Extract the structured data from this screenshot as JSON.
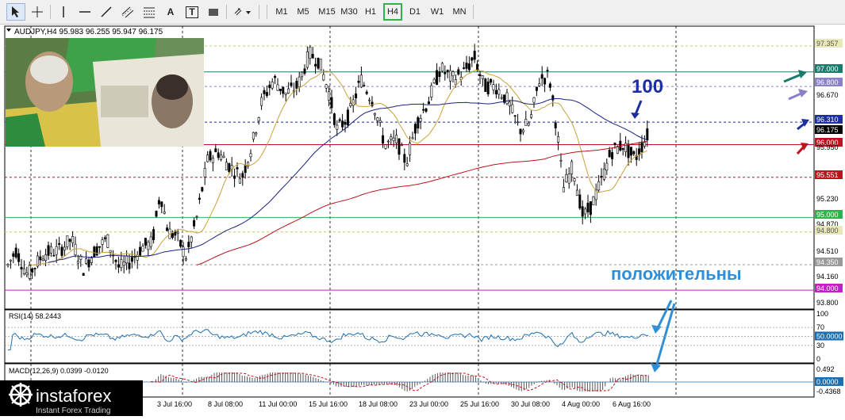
{
  "toolbar": {
    "tools": [
      {
        "name": "cursor-icon"
      },
      {
        "name": "crosshair-icon"
      },
      {
        "name": "vertical-line-icon"
      },
      {
        "name": "horizontal-line-icon"
      },
      {
        "name": "trendline-icon"
      },
      {
        "name": "channel-icon"
      },
      {
        "name": "fibonacci-icon"
      },
      {
        "name": "text-icon",
        "label": "A"
      },
      {
        "name": "text-label-icon",
        "label": "T"
      },
      {
        "name": "rectangle-icon"
      },
      {
        "name": "arrows-dropdown-icon"
      }
    ],
    "timeframes": [
      "M1",
      "M5",
      "M15",
      "M30",
      "H1",
      "H4",
      "D1",
      "W1",
      "MN"
    ],
    "active_timeframe": "H4"
  },
  "chart": {
    "info": "AUDJPY,H4  95.983 96.255 95.947 96.175",
    "price_labels": [
      {
        "text": "97.357",
        "bg": "#e9e9b8",
        "fg": "#555"
      },
      {
        "text": "97.000",
        "bg": "#1a7a6d",
        "fg": "#fff"
      },
      {
        "text": "96.800",
        "bg": "#8a82c8",
        "fg": "#fff"
      },
      {
        "text": "96.670",
        "bg": "",
        "fg": "#000"
      },
      {
        "text": "96.310",
        "bg": "#1b2fa0",
        "fg": "#fff"
      },
      {
        "text": "96.175",
        "bg": "#000000",
        "fg": "#fff"
      },
      {
        "text": "96.000",
        "bg": "#c0121e",
        "fg": "#fff"
      },
      {
        "text": "95.950",
        "bg": "",
        "fg": "#000"
      },
      {
        "text": "95.551",
        "bg": "#c0121e",
        "fg": "#fff"
      },
      {
        "text": "95.230",
        "bg": "",
        "fg": "#000"
      },
      {
        "text": "95.000",
        "bg": "#2db34a",
        "fg": "#fff"
      },
      {
        "text": "94.870",
        "bg": "",
        "fg": "#000"
      },
      {
        "text": "94.800",
        "bg": "#e9e9b8",
        "fg": "#555"
      },
      {
        "text": "94.510",
        "bg": "",
        "fg": "#000"
      },
      {
        "text": "94.350",
        "bg": "#9a9a9a",
        "fg": "#fff"
      },
      {
        "text": "94.160",
        "bg": "",
        "fg": "#000"
      },
      {
        "text": "94.000",
        "bg": "#c421c4",
        "fg": "#fff"
      },
      {
        "text": "93.800",
        "bg": "",
        "fg": "#000"
      }
    ],
    "annotation_100": "100",
    "annotation_text": "положительны",
    "time_labels": [
      "3 Jul 16:00",
      "8 Jul 08:00",
      "11 Jul 00:00",
      "15 Jul 16:00",
      "18 Jul 08:00",
      "23 Jul 00:00",
      "25 Jul 16:00",
      "30 Jul 08:00",
      "4 Aug 00:00",
      "6 Aug 16:00"
    ]
  },
  "rsi": {
    "info": "RSI(14) 58.2443",
    "scale": [
      "100",
      "70",
      "50.0000",
      "30",
      "0"
    ]
  },
  "macd": {
    "info": "MACD(12,26,9) 0.0399 -0.0120",
    "scale": [
      "0.492",
      "0.0000",
      "-0.4368"
    ]
  },
  "logo": {
    "brand": "instaforex",
    "tagline": "Instant Forex Trading"
  },
  "colors": {
    "ma_slow": "#b8141b",
    "ma_mid": "#1a237e",
    "ma_fast": "#c9a23a",
    "candles": "#000000",
    "rsi_line": "#1e6fb0",
    "annotation": "#2e8fd8"
  }
}
